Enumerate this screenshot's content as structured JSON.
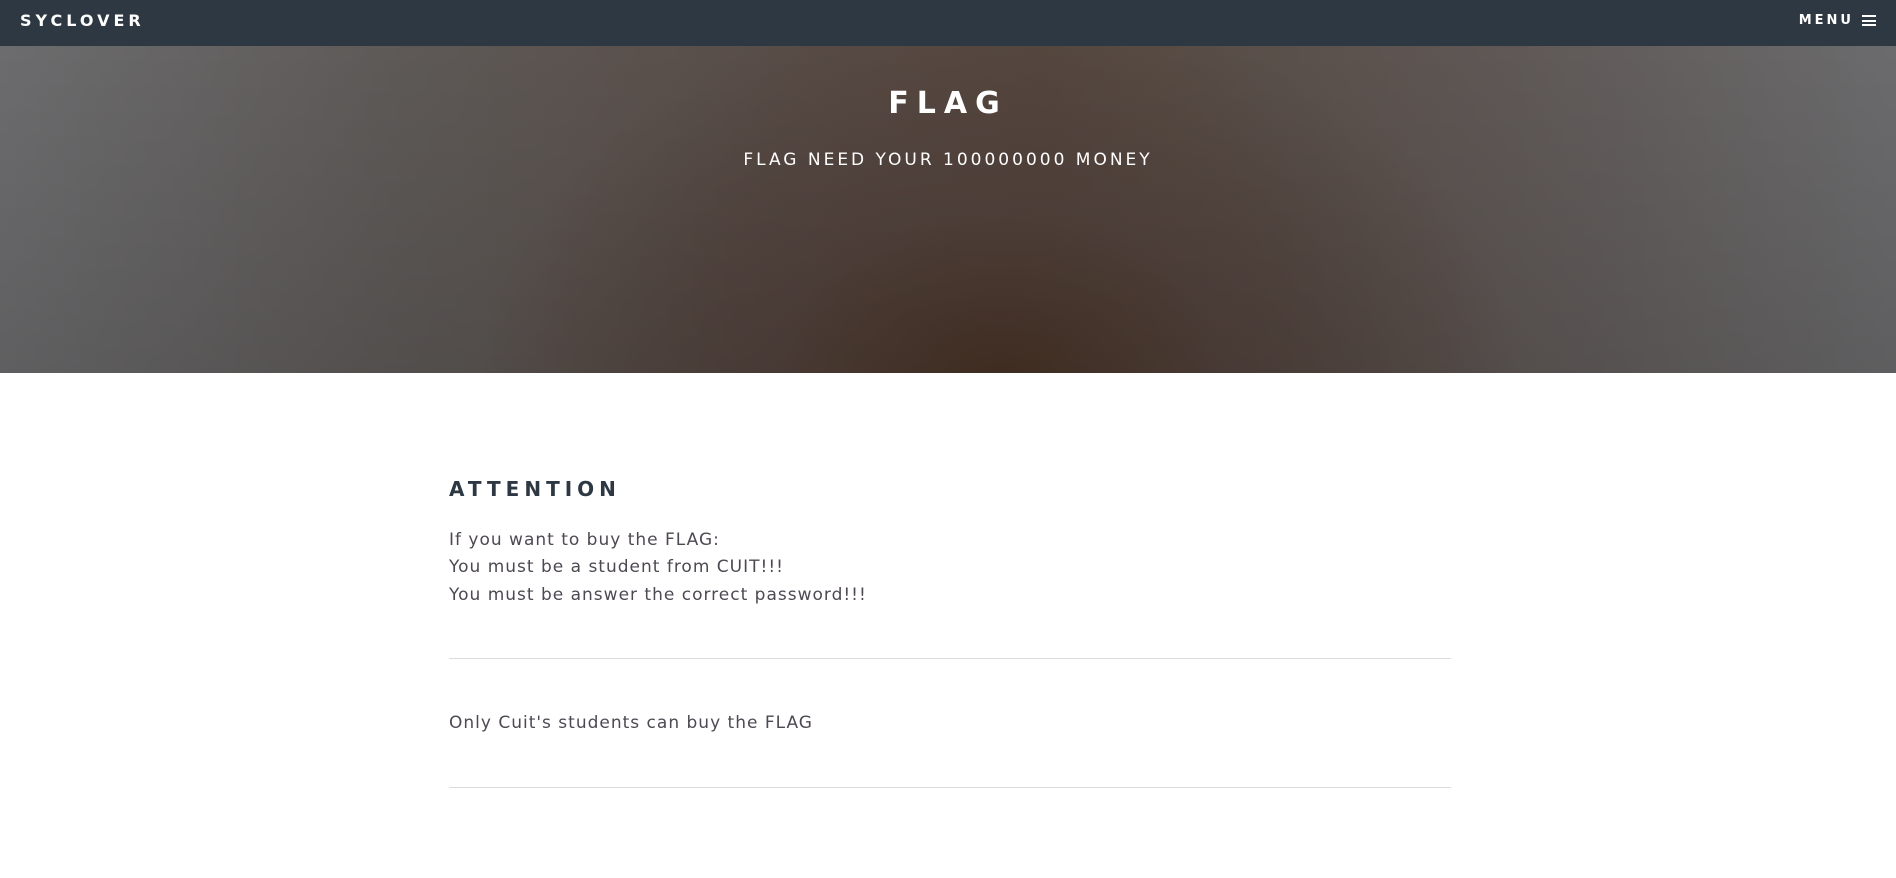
{
  "header": {
    "brand": "SYCLOVER",
    "menu_label": "MENU",
    "menu_icon": "hamburger-icon"
  },
  "hero": {
    "title": "FLAG",
    "subtitle": "FLAG NEED YOUR 100000000 MONEY"
  },
  "main": {
    "heading": "ATTENTION",
    "lines": [
      "If you want to buy the FLAG:",
      "You must be a student from CUIT!!!",
      "You must be answer the correct password!!!"
    ],
    "notice": "Only Cuit's students can buy the FLAG"
  },
  "colors": {
    "topbar": "#2e3842",
    "heading": "#2e3842",
    "body_text": "#4e4852",
    "divider": "#dcdcdc"
  }
}
